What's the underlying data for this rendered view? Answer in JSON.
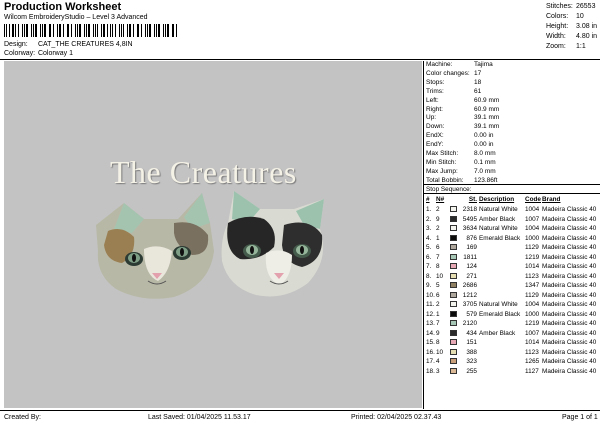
{
  "header": {
    "title": "Production Worksheet",
    "subtitle": "Wilcom EmbroideryStudio – Level 3 Advanced",
    "barcode_label": "barcode",
    "design_label": "Design:",
    "design_value": "CAT_THE CREATURES 4,8IN",
    "colorway_label": "Colorway:",
    "colorway_value": "Colorway 1"
  },
  "stats": [
    {
      "k": "Stitches:",
      "v": "26553"
    },
    {
      "k": "Colors:",
      "v": "10"
    },
    {
      "k": "Height:",
      "v": "3.08 in"
    },
    {
      "k": "Width:",
      "v": "4.80 in"
    },
    {
      "k": "Zoom:",
      "v": "1:1"
    }
  ],
  "canvas": {
    "background": "#c3c3c3",
    "title_text": "The Creatures",
    "image_description_icon": "cat-heads-embroidery-image"
  },
  "machine_info": [
    {
      "k": "Machine:",
      "v": "Tajima"
    },
    {
      "k": "Color changes:",
      "v": "17"
    },
    {
      "k": "Stops:",
      "v": "18"
    },
    {
      "k": "Trims:",
      "v": "61"
    },
    {
      "k": "Left:",
      "v": "60.9 mm"
    },
    {
      "k": "Right:",
      "v": "60.9 mm"
    },
    {
      "k": "Up:",
      "v": "39.1 mm"
    },
    {
      "k": "Down:",
      "v": "39.1 mm"
    },
    {
      "k": "EndX:",
      "v": "0.00 in"
    },
    {
      "k": "EndY:",
      "v": "0.00 in"
    },
    {
      "k": "Max Stitch:",
      "v": "8.0 mm"
    },
    {
      "k": "Min Stitch:",
      "v": "0.1 mm"
    },
    {
      "k": "Max Jump:",
      "v": "7.0 mm"
    },
    {
      "k": "Total Bobbin:",
      "v": "123.86ft"
    }
  ],
  "sequence": {
    "title": "Stop Sequence:",
    "headers": [
      "#",
      "N#",
      "St.",
      "Description",
      "Code",
      "Brand"
    ],
    "rows": [
      {
        "n": "1.",
        "needle": "2",
        "color": "#f4f4ee",
        "st": "2318",
        "desc": "Natural White",
        "code": "1004",
        "brand": "Madeira Classic 40"
      },
      {
        "n": "2.",
        "needle": "9",
        "color": "#2b2b2b",
        "st": "5495",
        "desc": "Amber Black",
        "code": "1007",
        "brand": "Madeira Classic 40"
      },
      {
        "n": "3.",
        "needle": "2",
        "color": "#f4f4ee",
        "st": "3634",
        "desc": "Natural White",
        "code": "1004",
        "brand": "Madeira Classic 40"
      },
      {
        "n": "4.",
        "needle": "1",
        "color": "#0a0a0a",
        "st": "876",
        "desc": "Emerald Black",
        "code": "1000",
        "brand": "Madeira Classic 40"
      },
      {
        "n": "5.",
        "needle": "6",
        "color": "#ada69d",
        "st": "169",
        "desc": "",
        "code": "1129",
        "brand": "Madeira Classic 40"
      },
      {
        "n": "6.",
        "needle": "7",
        "color": "#a6c7b6",
        "st": "1811",
        "desc": "",
        "code": "1219",
        "brand": "Madeira Classic 40"
      },
      {
        "n": "7.",
        "needle": "8",
        "color": "#e6a8b4",
        "st": "124",
        "desc": "",
        "code": "1014",
        "brand": "Madeira Classic 40"
      },
      {
        "n": "8.",
        "needle": "10",
        "color": "#e7dfb4",
        "st": "271",
        "desc": "",
        "code": "1123",
        "brand": "Madeira Classic 40"
      },
      {
        "n": "9.",
        "needle": "5",
        "color": "#8f8064",
        "st": "2686",
        "desc": "",
        "code": "1347",
        "brand": "Madeira Classic 40"
      },
      {
        "n": "10.",
        "needle": "6",
        "color": "#ada69d",
        "st": "1212",
        "desc": "",
        "code": "1129",
        "brand": "Madeira Classic 40"
      },
      {
        "n": "11.",
        "needle": "2",
        "color": "#f4f4ee",
        "st": "3705",
        "desc": "Natural White",
        "code": "1004",
        "brand": "Madeira Classic 40"
      },
      {
        "n": "12.",
        "needle": "1",
        "color": "#0a0a0a",
        "st": "579",
        "desc": "Emerald Black",
        "code": "1000",
        "brand": "Madeira Classic 40"
      },
      {
        "n": "13.",
        "needle": "7",
        "color": "#a6c7b6",
        "st": "2120",
        "desc": "",
        "code": "1219",
        "brand": "Madeira Classic 40"
      },
      {
        "n": "14.",
        "needle": "9",
        "color": "#2b2b2b",
        "st": "434",
        "desc": "Amber Black",
        "code": "1007",
        "brand": "Madeira Classic 40"
      },
      {
        "n": "15.",
        "needle": "8",
        "color": "#e6a8b4",
        "st": "151",
        "desc": "",
        "code": "1014",
        "brand": "Madeira Classic 40"
      },
      {
        "n": "16.",
        "needle": "10",
        "color": "#e7dfb4",
        "st": "388",
        "desc": "",
        "code": "1123",
        "brand": "Madeira Classic 40"
      },
      {
        "n": "17.",
        "needle": "4",
        "color": "#c9a07a",
        "st": "323",
        "desc": "",
        "code": "1265",
        "brand": "Madeira Classic 40"
      },
      {
        "n": "18.",
        "needle": "3",
        "color": "#dcb996",
        "st": "255",
        "desc": "",
        "code": "1127",
        "brand": "Madeira Classic 40"
      }
    ]
  },
  "footer": {
    "created_by": "Created By:",
    "last_saved": "Last Saved: 01/04/2025 11.53.17",
    "printed": "Printed: 02/04/2025 02.37.43",
    "page": "Page 1 of 1"
  }
}
